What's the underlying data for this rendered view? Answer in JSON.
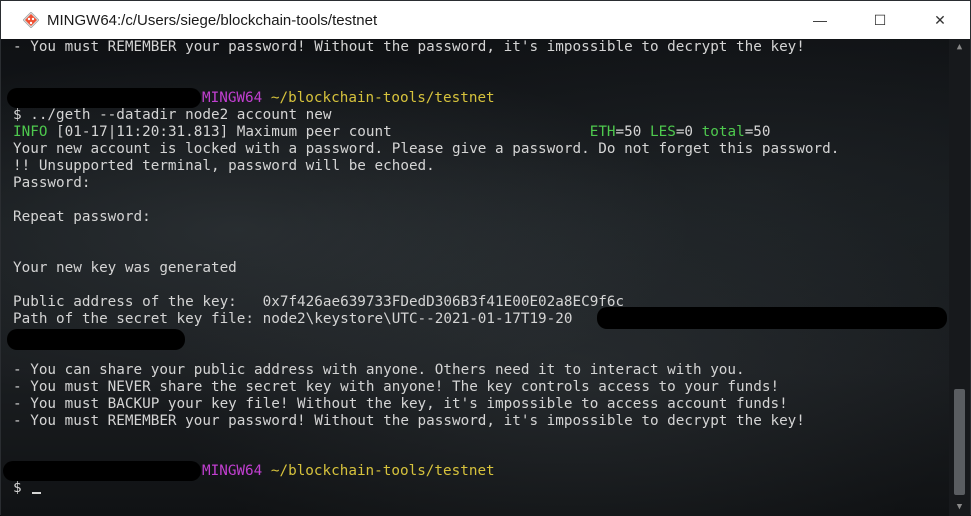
{
  "window": {
    "title": "MINGW64:/c/Users/siege/blockchain-tools/testnet",
    "controls": {
      "minimize": "—",
      "maximize": "☐",
      "close": "✕"
    }
  },
  "terminal": {
    "line_remember_top": "- You must REMEMBER your password! Without the password, it's impossible to decrypt the key!",
    "prompt1_host": "MINGW64",
    "prompt1_path": "~/blockchain-tools/testnet",
    "command": "$ ../geth --datadir node2 account new",
    "info_level": "INFO",
    "info_text": " [01-17|11:20:31.813] Maximum peer count                       ",
    "info_eth_key": "ETH",
    "info_eth_val": "=50 ",
    "info_les_key": "LES",
    "info_les_val": "=0 ",
    "info_total_key": "total",
    "info_total_val": "=50",
    "locked_msg": "Your new account is locked with a password. Please give a password. Do not forget this password.",
    "unsupported_msg": "!! Unsupported terminal, password will be echoed.",
    "password_prompt": "Password:",
    "repeat_prompt": "Repeat password:",
    "generated_msg": "Your new key was generated",
    "public_address_line": "Public address of the key:   0x7f426ae639733FDedD306B3f41E00E02a8EC9f6c",
    "secret_path_line": "Path of the secret key file: node2\\keystore\\UTC--2021-01-17T19-20",
    "share_msg": "- You can share your public address with anyone. Others need it to interact with you.",
    "never_msg": "- You must NEVER share the secret key with anyone! The key controls access to your funds!",
    "backup_msg": "- You must BACKUP your key file! Without the key, it's impossible to access account funds!",
    "remember_msg": "- You must REMEMBER your password! Without the password, it's impossible to decrypt the key!",
    "prompt2_host": "MINGW64",
    "prompt2_path": "~/blockchain-tools/testnet",
    "final_prompt": "$ "
  },
  "colors": {
    "green": "#4ec94e",
    "magenta": "#c13fd0",
    "yellow": "#d6c23c",
    "cyan": "#3ec6c6"
  }
}
